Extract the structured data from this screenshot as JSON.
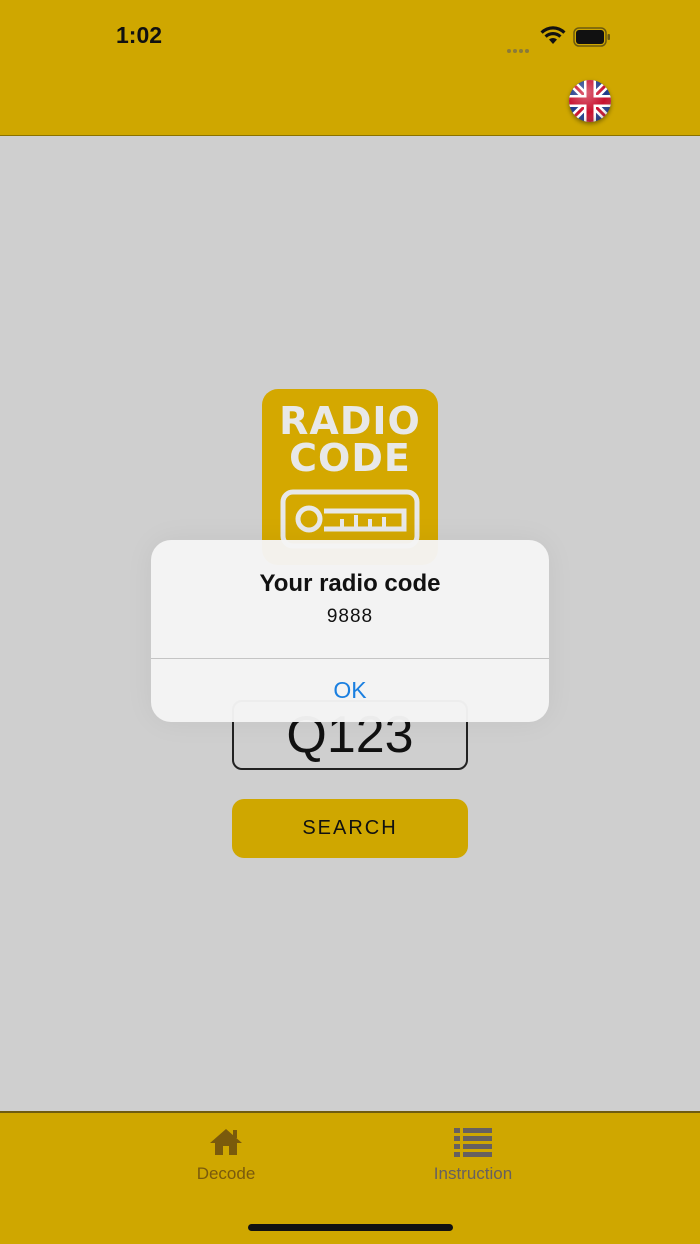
{
  "status_bar": {
    "time": "1:02"
  },
  "header": {
    "language_flag": "uk-flag-icon"
  },
  "logo": {
    "line1": "RADIO",
    "line2": "CODE"
  },
  "code_field": {
    "value": "Q123"
  },
  "search_button": {
    "label": "SEARCH"
  },
  "alert": {
    "title": "Your radio code",
    "message": "9888",
    "ok_label": "OK"
  },
  "tabbar": {
    "tabs": [
      {
        "label": "Decode",
        "icon": "home-icon",
        "active": true
      },
      {
        "label": "Instruction",
        "icon": "list-icon",
        "active": false
      }
    ]
  },
  "colors": {
    "accent": "#cfa700",
    "background": "#cfcfcf",
    "alert_button": "#1a7fe0"
  }
}
